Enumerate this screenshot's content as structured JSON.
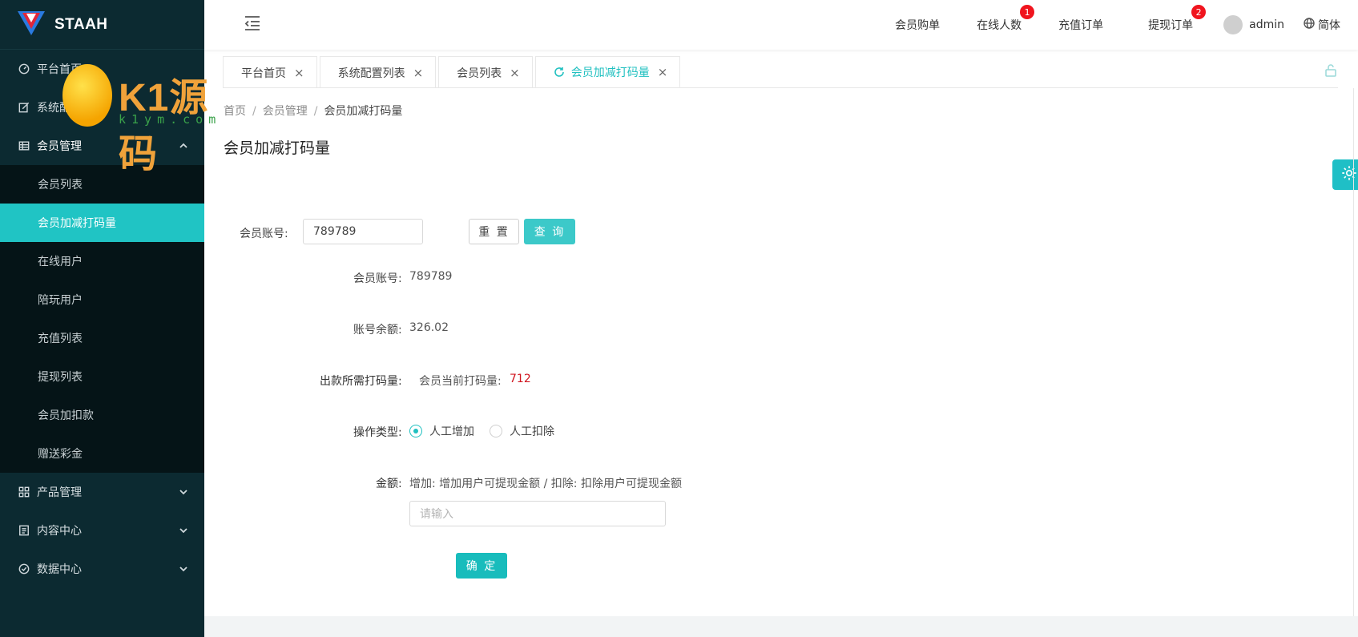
{
  "brand": {
    "name": "STAAH"
  },
  "watermark": {
    "title": "K1源码",
    "sub": "k1ym.com"
  },
  "sidebar": {
    "items": [
      {
        "label": "平台首页",
        "icon": "dashboard-icon"
      },
      {
        "label": "系统配置",
        "icon": "edit-icon"
      },
      {
        "label": "会员管理",
        "icon": "table-icon",
        "open": true
      },
      {
        "label": "产品管理",
        "icon": "grid-icon"
      },
      {
        "label": "内容中心",
        "icon": "document-icon"
      },
      {
        "label": "数据中心",
        "icon": "check-circle-icon"
      }
    ],
    "member_sub": [
      {
        "label": "会员列表"
      },
      {
        "label": "会员加减打码量",
        "active": true
      },
      {
        "label": "在线用户"
      },
      {
        "label": "陪玩用户"
      },
      {
        "label": "充值列表"
      },
      {
        "label": "提现列表"
      },
      {
        "label": "会员加扣款"
      },
      {
        "label": "赠送彩金"
      }
    ]
  },
  "header": {
    "nav": [
      {
        "label": "会员购单"
      },
      {
        "label": "在线人数",
        "badge": "1"
      },
      {
        "label": "充值订单"
      },
      {
        "label": "提现订单",
        "badge": "2"
      }
    ],
    "user": "admin",
    "lang": "简体"
  },
  "tabs": [
    {
      "label": "平台首页"
    },
    {
      "label": "系统配置列表"
    },
    {
      "label": "会员列表"
    },
    {
      "label": "会员加减打码量",
      "active": true
    }
  ],
  "breadcrumb": [
    "首页",
    "会员管理",
    "会员加减打码量"
  ],
  "page_title": "会员加减打码量",
  "search": {
    "label": "会员账号:",
    "value": "789789",
    "reset": "重 置",
    "query": "查 询"
  },
  "info": {
    "account_label": "会员账号:",
    "account_value": "789789",
    "balance_label": "账号余额:",
    "balance_value": "326.02",
    "need_label": "出款所需打码量:",
    "current_label": "会员当前打码量:",
    "current_value": "712"
  },
  "op": {
    "label": "操作类型:",
    "add": "人工增加",
    "deduct": "人工扣除",
    "selected": "add"
  },
  "amount": {
    "label": "金额:",
    "hint": "增加: 增加用户可提现金额 / 扣除: 扣除用户可提现金额",
    "placeholder": "请输入",
    "submit": "确 定"
  },
  "colors": {
    "sidebar": "#0c2a31",
    "accent": "#20c4c4",
    "badge": "#f0141e"
  }
}
